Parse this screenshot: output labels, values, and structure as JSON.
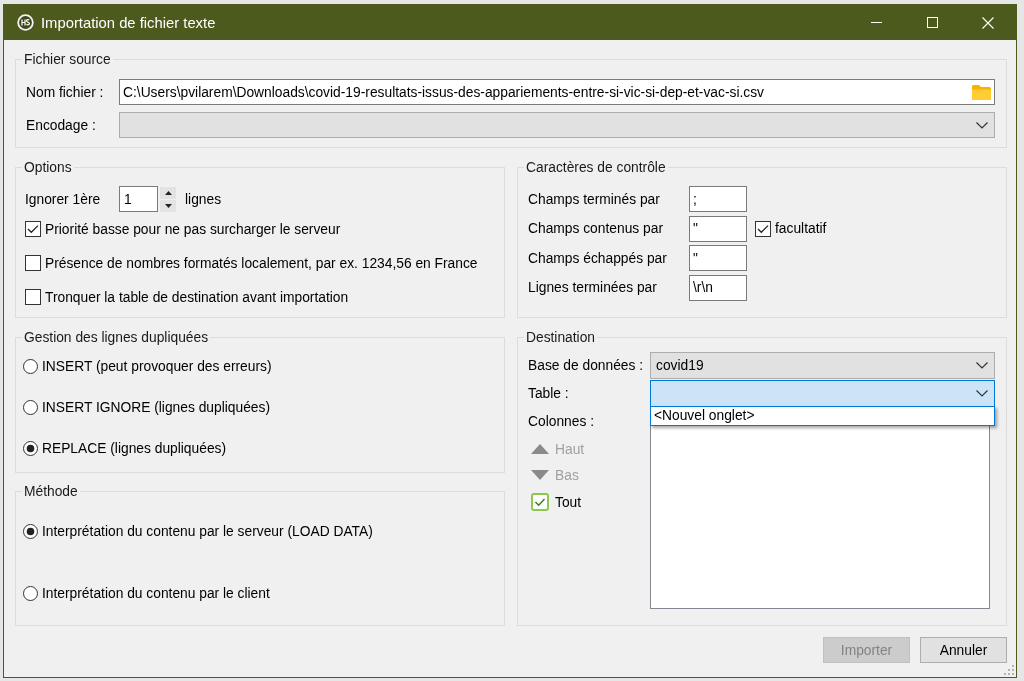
{
  "window": {
    "title": "Importation de fichier texte"
  },
  "source_file": {
    "title": "Fichier source",
    "fields": [
      {
        "kind": "file",
        "label": "Nom fichier :",
        "value": "C:\\Users\\pvilarem\\Downloads\\covid-19-resultats-issus-des-appariements-entre-si-vic-si-dep-et-vac-si.csv"
      },
      {
        "kind": "combo",
        "label": "Encodage :"
      }
    ]
  },
  "options": {
    "title": "Options",
    "skip_lines": {
      "label": "Ignorer 1ère",
      "value": "1",
      "unit": "lignes"
    },
    "checkboxes": [
      {
        "label": "Priorité basse pour ne pas surcharger le serveur",
        "checked": true
      },
      {
        "label": "Présence de nombres formatés localement, par ex. 1234,56 en France",
        "checked": false
      },
      {
        "label": "Tronquer la table de destination avant importation",
        "checked": false
      }
    ]
  },
  "duplicates": {
    "title": "Gestion des lignes dupliquées",
    "radios": [
      {
        "label": "INSERT (peut provoquer des erreurs)",
        "selected": false
      },
      {
        "label": "INSERT IGNORE (lignes dupliquées)",
        "selected": false
      },
      {
        "label": "REPLACE (lignes dupliquées)",
        "selected": true
      }
    ]
  },
  "method": {
    "title": "Méthode",
    "radios": [
      {
        "label": "Interprétation du contenu par le serveur (LOAD DATA)",
        "selected": true
      },
      {
        "label": "Interprétation du contenu par le client",
        "selected": false
      }
    ]
  },
  "control_chars": {
    "title": "Caractères de contrôle",
    "fields": [
      {
        "label": "Champs terminés par",
        "value": ";"
      },
      {
        "label": "Champs contenus par",
        "value": "\"",
        "option": {
          "label": "facultatif",
          "checked": true
        }
      },
      {
        "label": "Champs échappés par",
        "value": "\""
      },
      {
        "label": "Lignes terminées par",
        "value": "\\r\\n"
      }
    ]
  },
  "destination": {
    "title": "Destination",
    "database": {
      "label": "Base de données :",
      "value": "covid19"
    },
    "table": {
      "label": "Table :",
      "expanded": true,
      "options": [
        {
          "label": "<Nouvel onglet>",
          "selected": false
        }
      ]
    },
    "columns": {
      "label": "Colonnes :",
      "buttons": [
        {
          "kind": "up",
          "label": "Haut",
          "disabled": true
        },
        {
          "kind": "down",
          "label": "Bas",
          "disabled": true
        }
      ],
      "select_all": {
        "label": "Tout",
        "checked": true
      }
    }
  },
  "buttons": [
    {
      "label": "Importer",
      "disabled": true
    },
    {
      "label": "Annuler",
      "disabled": false
    }
  ]
}
